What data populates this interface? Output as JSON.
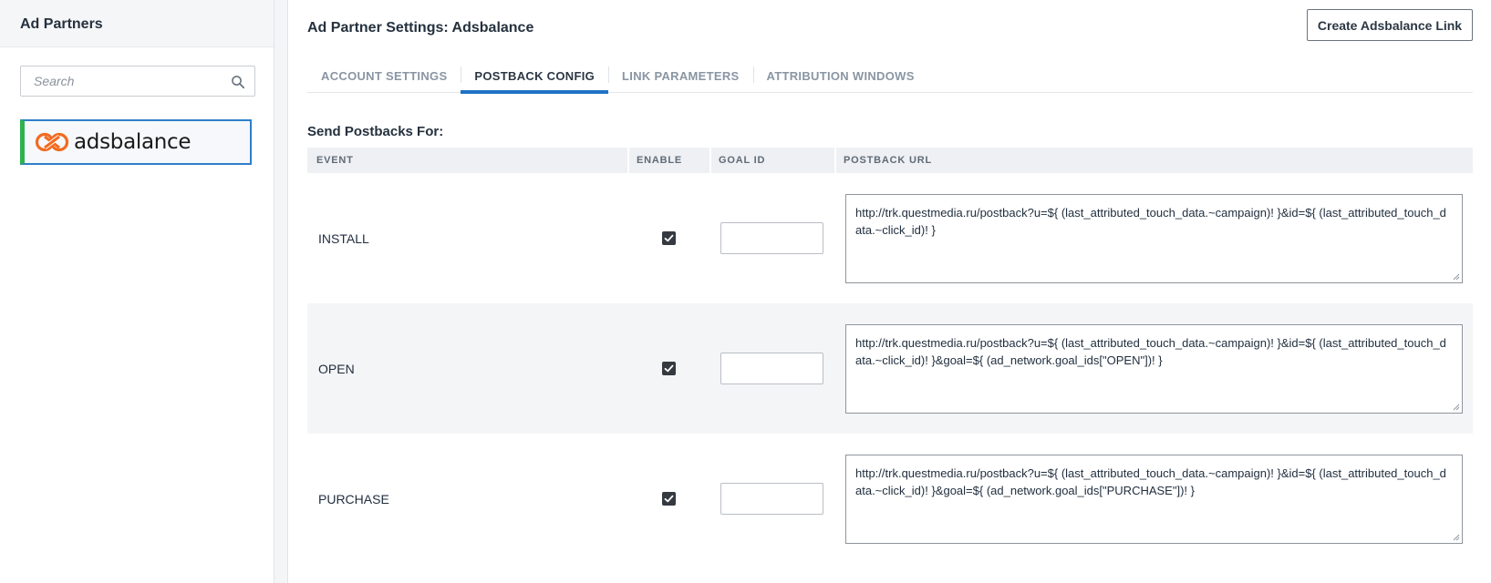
{
  "sidebar": {
    "title": "Ad Partners",
    "search_placeholder": "Search",
    "partners": [
      {
        "name": "adsbalance"
      }
    ]
  },
  "main": {
    "title": "Ad Partner Settings: Adsbalance",
    "create_button": "Create Adsbalance Link",
    "tabs": [
      {
        "label": "ACCOUNT SETTINGS",
        "active": false
      },
      {
        "label": "POSTBACK CONFIG",
        "active": true
      },
      {
        "label": "LINK PARAMETERS",
        "active": false
      },
      {
        "label": "ATTRIBUTION WINDOWS",
        "active": false
      }
    ],
    "section_label": "Send Postbacks For:",
    "table": {
      "headers": {
        "event": "EVENT",
        "enable": "ENABLE",
        "goal_id": "GOAL ID",
        "postback_url": "POSTBACK URL"
      },
      "rows": [
        {
          "event": "INSTALL",
          "enabled": true,
          "goal_id": "",
          "postback_url": "http://trk.questmedia.ru/postback?u=${ (last_attributed_touch_data.~campaign)! }&id=${ (last_attributed_touch_data.~click_id)! }"
        },
        {
          "event": "OPEN",
          "enabled": true,
          "goal_id": "",
          "postback_url": "http://trk.questmedia.ru/postback?u=${ (last_attributed_touch_data.~campaign)! }&id=${ (last_attributed_touch_data.~click_id)! }&goal=${ (ad_network.goal_ids[\"OPEN\"])! }"
        },
        {
          "event": "PURCHASE",
          "enabled": true,
          "goal_id": "",
          "postback_url": "http://trk.questmedia.ru/postback?u=${ (last_attributed_touch_data.~campaign)! }&id=${ (last_attributed_touch_data.~click_id)! }&goal=${ (ad_network.goal_ids[\"PURCHASE\"])! }"
        }
      ]
    }
  },
  "colors": {
    "accent": "#1f73c7",
    "selected_border": "#2f7fc9",
    "selected_marker": "#2eb24e",
    "logo_orange": "#f26b21"
  },
  "icons": {
    "search": "search-icon",
    "checkbox": "checkbox-checked-icon",
    "logo": "adsbalance-logo-icon",
    "resize": "resize-grip-icon"
  }
}
